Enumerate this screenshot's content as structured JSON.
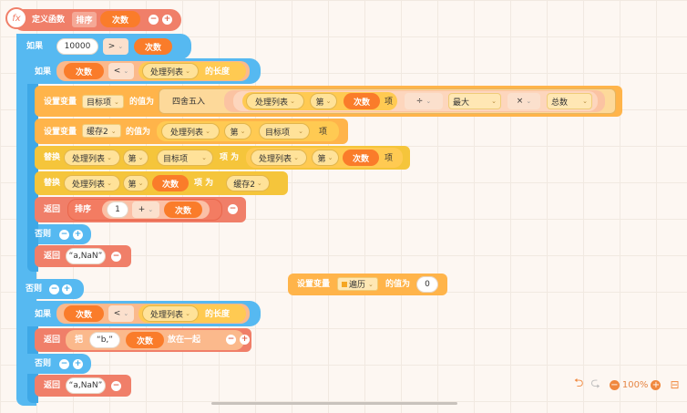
{
  "define": {
    "label": "定义函数",
    "name": "排序",
    "param": "次数",
    "icon": "fx"
  },
  "if1": {
    "label": "如果",
    "value": "10000",
    "op": ">",
    "var": "次数"
  },
  "if2": {
    "label": "如果",
    "var": "次数",
    "op": "<",
    "list": "处理列表",
    "suffix": "的长度"
  },
  "set1": {
    "label": "设置变量",
    "var": "目标项",
    "as": "的值为",
    "round": "四舍五入",
    "list": "处理列表",
    "nth": "第",
    "idx": "次数",
    "item": "项",
    "op1": "÷",
    "max": "最大",
    "op2": "×",
    "total": "总数"
  },
  "set2": {
    "label": "设置变量",
    "var": "缓存2",
    "as": "的值为",
    "list": "处理列表",
    "nth": "第",
    "idx": "目标项",
    "item": "项"
  },
  "rep1": {
    "label": "替换",
    "list": "处理列表",
    "nth": "第",
    "idx": "目标项",
    "item": "项 为",
    "list2": "处理列表",
    "nth2": "第",
    "idx2": "次数",
    "item2": "项"
  },
  "rep2": {
    "label": "替换",
    "list": "处理列表",
    "nth": "第",
    "idx": "次数",
    "item": "项 为",
    "val": "缓存2"
  },
  "ret1": {
    "label": "返回",
    "fn": "排序",
    "num": "1",
    "op": "+",
    "var": "次数"
  },
  "else1": {
    "label": "否则"
  },
  "ret2": {
    "label": "返回",
    "val": "a,NaN"
  },
  "else2": {
    "label": "否则"
  },
  "if3": {
    "label": "如果",
    "var": "次数",
    "op": "<",
    "list": "处理列表",
    "suffix": "的长度"
  },
  "ret3": {
    "label": "返回",
    "join": "把",
    "str": "b,",
    "var": "次数",
    "suffix": "放在一起"
  },
  "else3": {
    "label": "否则"
  },
  "ret4": {
    "label": "返回",
    "val": "a,NaN"
  },
  "floating": {
    "label": "设置变量",
    "var": "遍历",
    "as": "的值为",
    "value": "0"
  },
  "controls": {
    "zoom": "100%"
  }
}
